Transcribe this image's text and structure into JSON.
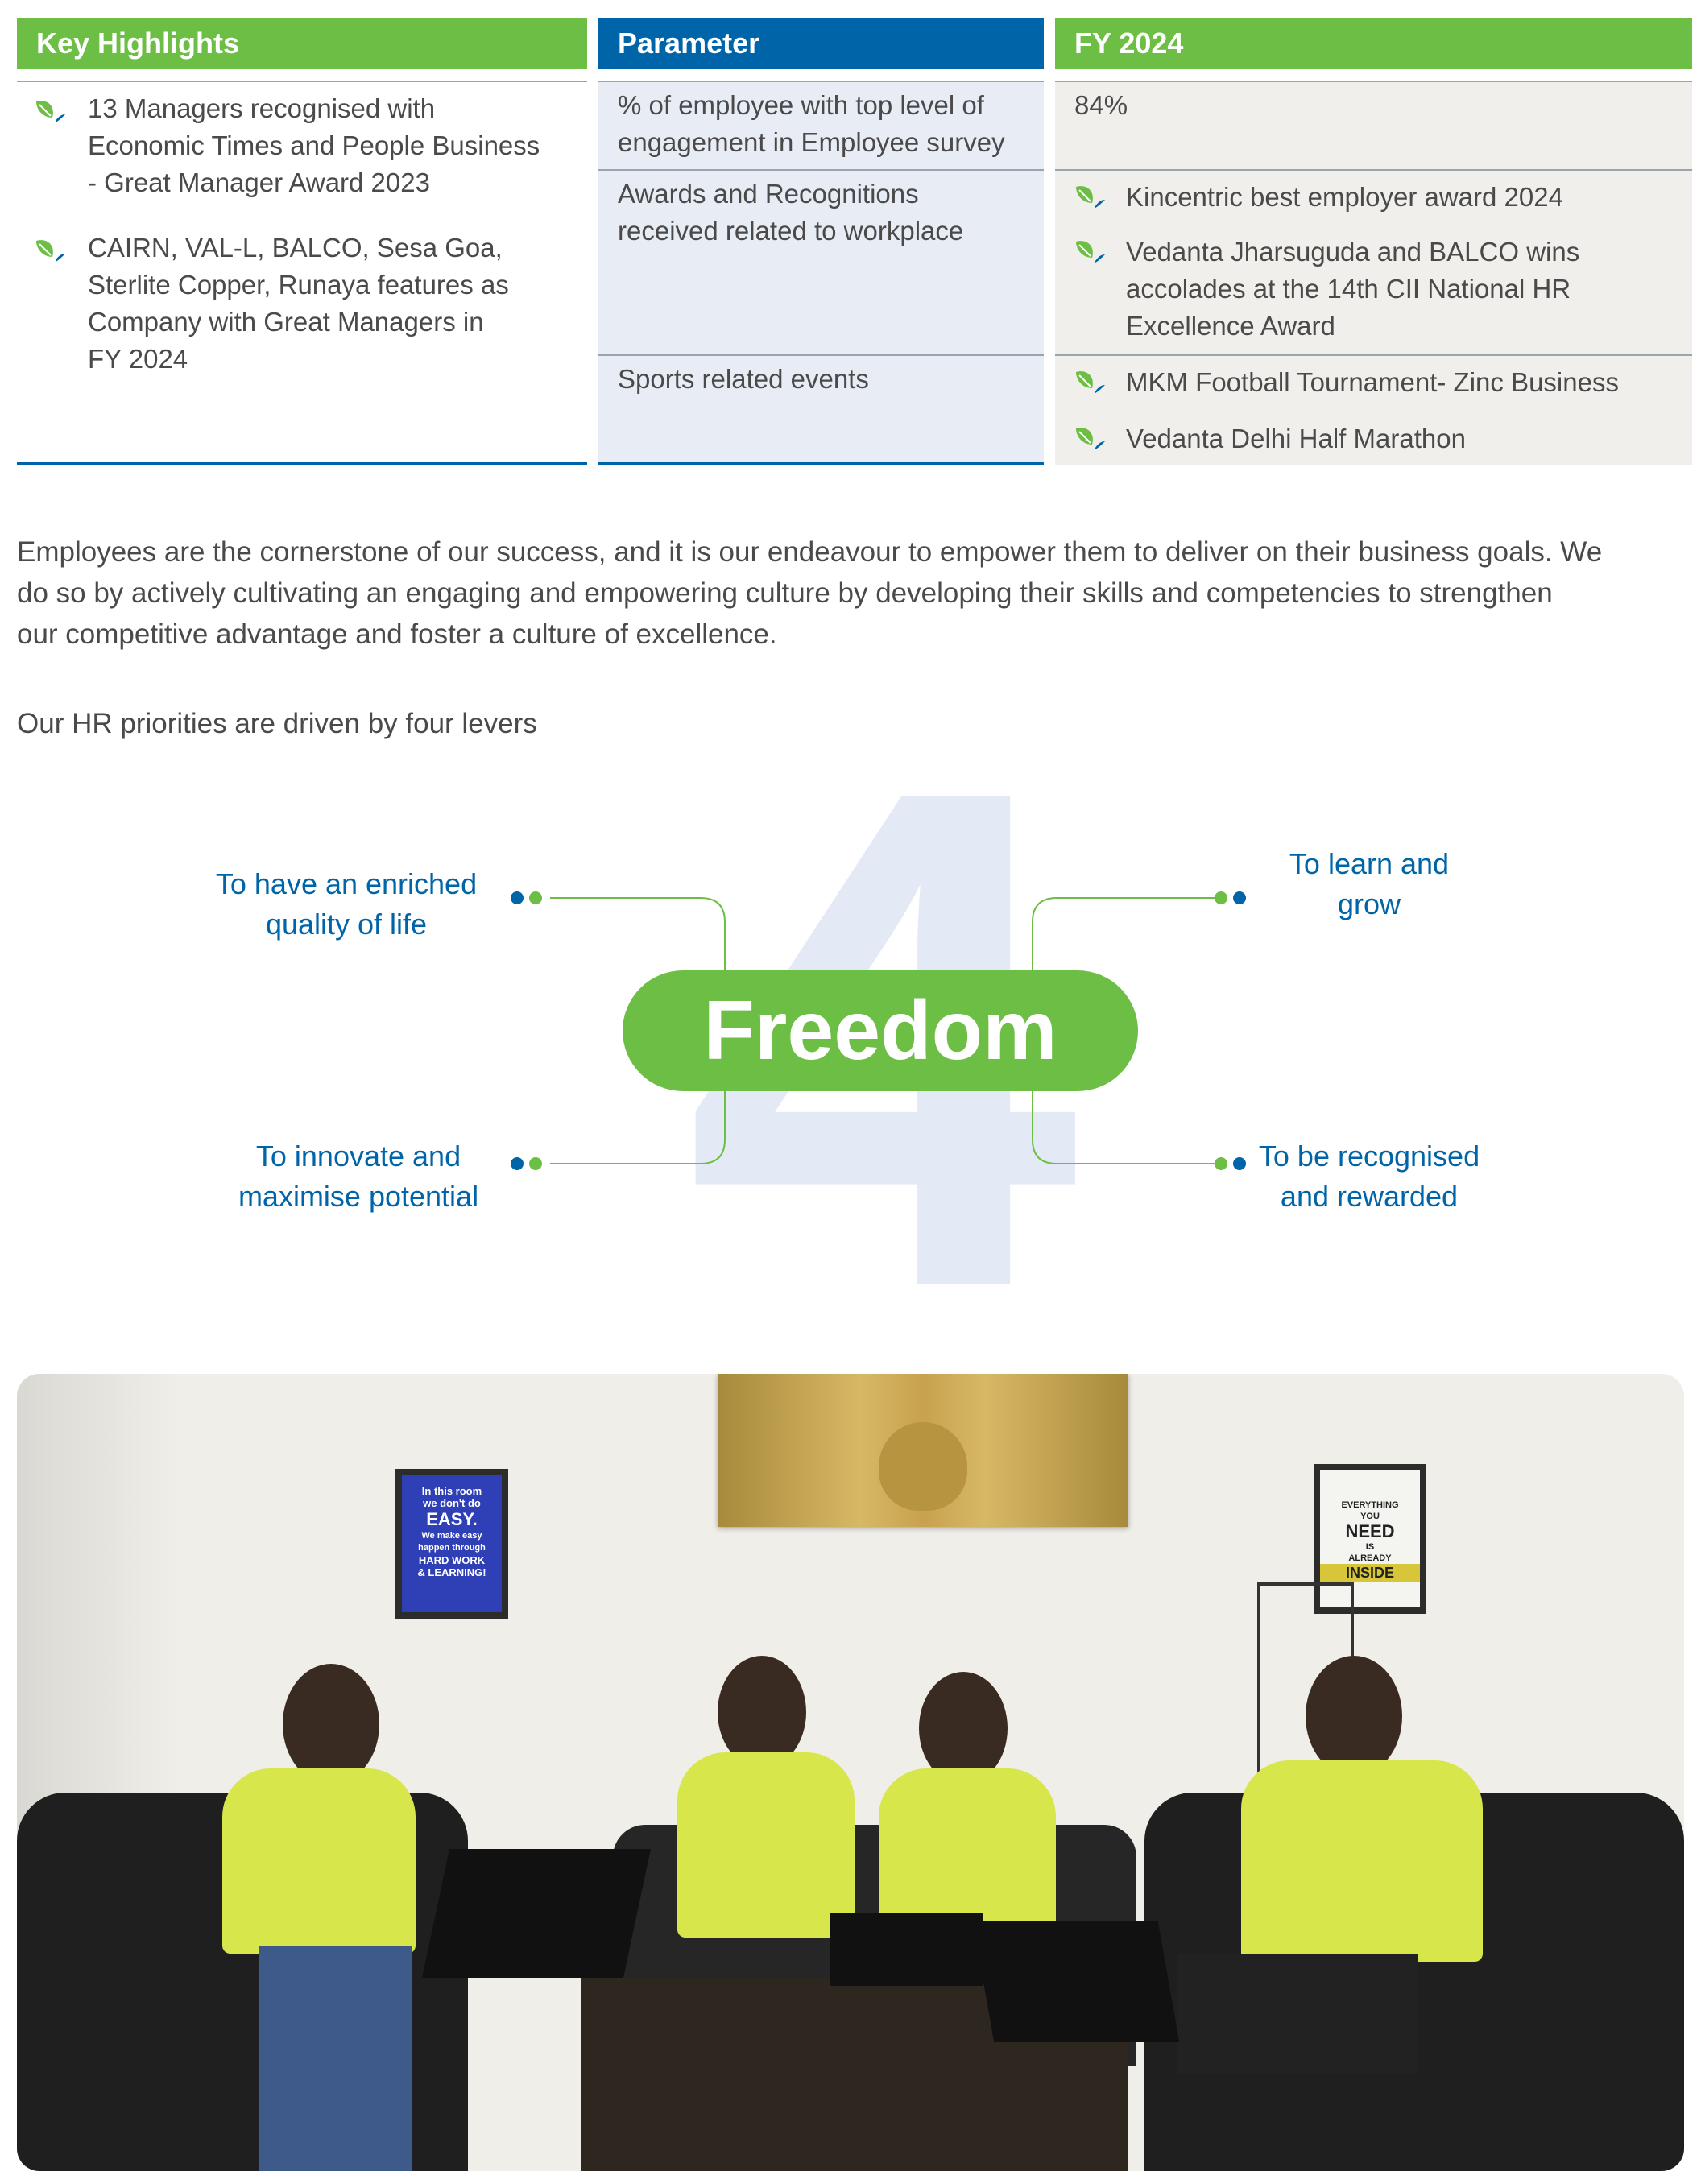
{
  "table": {
    "headers": {
      "key_highlights": "Key Highlights",
      "parameter": "Parameter",
      "fy": "FY 2024"
    },
    "highlights": [
      {
        "lines": [
          "13 Managers recognised with",
          "Economic Times and People Business",
          "- Great Manager Award 2023"
        ]
      },
      {
        "lines": [
          "CAIRN, VAL-L, BALCO, Sesa Goa,",
          "Sterlite Copper, Runaya features as",
          "Company with Great Managers in",
          "FY 2024"
        ]
      }
    ],
    "rows": [
      {
        "parameter_lines": [
          "% of employee with top level of",
          "engagement in Employee survey"
        ],
        "value": "84%"
      },
      {
        "parameter_lines": [
          "Awards and Recognitions",
          "received related to workplace"
        ],
        "awards": [
          {
            "lines": [
              "Kincentric best employer award 2024"
            ]
          },
          {
            "lines": [
              "Vedanta Jharsuguda and BALCO wins",
              "accolades at the 14th CII National HR",
              "Excellence Award"
            ]
          }
        ]
      },
      {
        "parameter_lines": [
          "Sports related events"
        ],
        "awards": [
          {
            "lines": [
              "MKM Football Tournament- Zinc Business"
            ]
          },
          {
            "lines": [
              "Vedanta Delhi Half Marathon"
            ]
          }
        ]
      }
    ]
  },
  "paragraph": {
    "lines": [
      "Employees are the cornerstone of our success, and it is our endeavour to empower them to deliver on their business goals. We",
      "do so by actively cultivating an engaging and empowering culture by developing their skills and competencies to strengthen",
      "our competitive advantage and foster a culture of excellence."
    ],
    "levers_intro": "Our HR priorities are driven by four levers"
  },
  "diagram": {
    "big_number": "4",
    "center_label": "Freedom",
    "levers": {
      "top_left": [
        "To have an enriched",
        "quality of life"
      ],
      "top_right": [
        "To learn and",
        "grow"
      ],
      "bottom_left": [
        "To innovate and",
        "maximise potential"
      ],
      "bottom_right": [
        "To be recognised",
        "and rewarded"
      ]
    }
  },
  "photo": {
    "poster_left": [
      "In this room",
      "we don't do",
      "EASY.",
      "We make easy",
      "happen through",
      "HARD WORK",
      "& LEARNING!"
    ],
    "poster_right": [
      "EVERYTHING",
      "YOU",
      "NEED",
      "IS",
      "ALREADY",
      "INSIDE"
    ]
  },
  "colors": {
    "green": "#6dbe45",
    "blue": "#0065a8",
    "light_blue_bg": "#e8ecf5",
    "grey_bg": "#f0efeb",
    "big_number": "#e3eaf5"
  },
  "icons": {
    "bullet": "leaf-icon"
  }
}
